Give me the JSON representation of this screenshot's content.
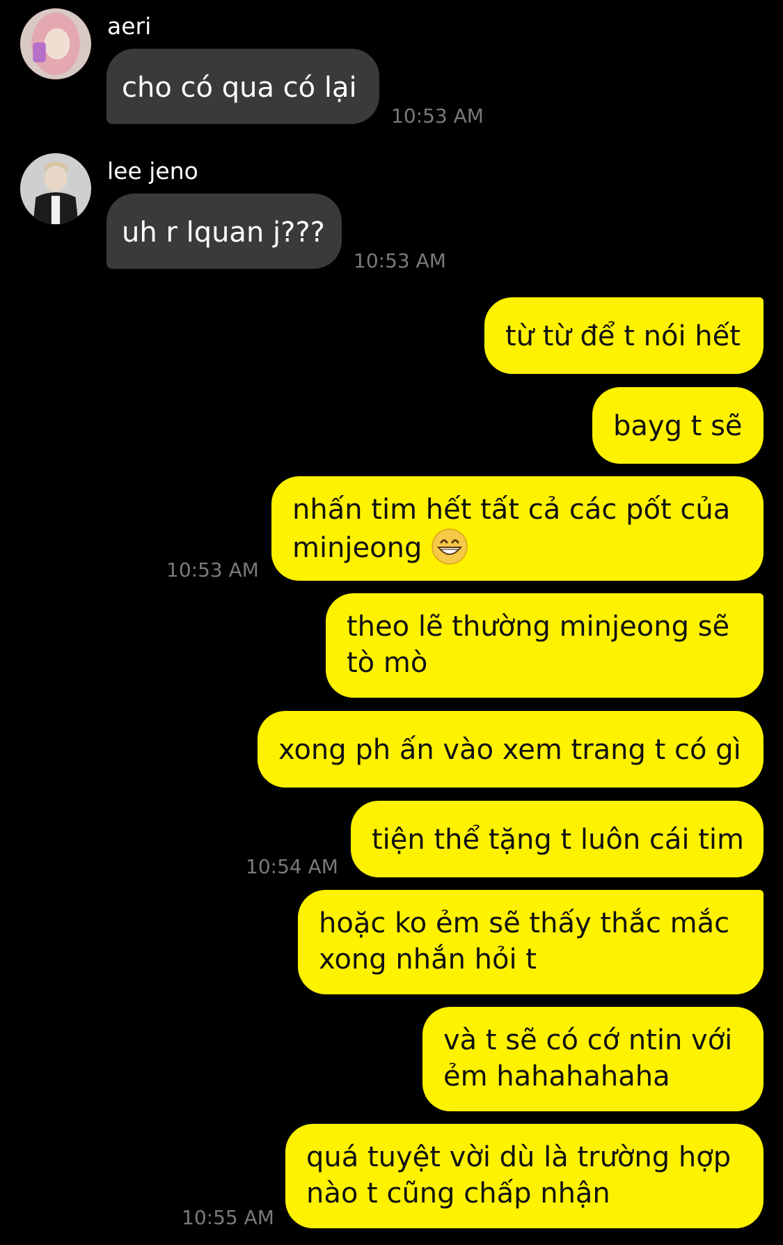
{
  "conversation": {
    "incoming": [
      {
        "sender": "aeri",
        "text": "cho có qua có lại",
        "time": "10:53 AM"
      },
      {
        "sender": "lee jeno",
        "text": "uh r lquan j???",
        "time": "10:53 AM"
      }
    ],
    "outgoing": [
      {
        "text": "từ từ để t nói hết"
      },
      {
        "text": "bayg t sẽ"
      },
      {
        "line1": "nhấn tim hết tất cả các pốt của",
        "line2": "minjeong",
        "time": "10:53 AM"
      },
      {
        "line1": "theo lẽ thường minjeong sẽ",
        "line2": "tò mò"
      },
      {
        "text": "xong ph ấn vào xem trang t có gì"
      },
      {
        "text": "tiện thể tặng t luôn cái tim",
        "time": "10:54 AM"
      },
      {
        "line1": "hoặc ko ẻm sẽ thấy thắc mắc",
        "line2": "xong nhắn hỏi t"
      },
      {
        "line1": "và t sẽ có cớ ntin với",
        "line2": "ẻm hahahahaha"
      },
      {
        "line1": "quá tuyệt vời dù là trường hợp",
        "line2": "nào t cũng chấp nhận",
        "time": "10:55 AM"
      }
    ]
  },
  "icons": {
    "avatar_aeri": "avatar-aeri",
    "avatar_jeno": "avatar-lee-jeno",
    "emoji": "grinning-face-icon"
  },
  "colors": {
    "background": "#000000",
    "incoming_bubble": "#3a3a3c",
    "outgoing_bubble": "#fff200",
    "timestamp": "#7a7a7a"
  }
}
